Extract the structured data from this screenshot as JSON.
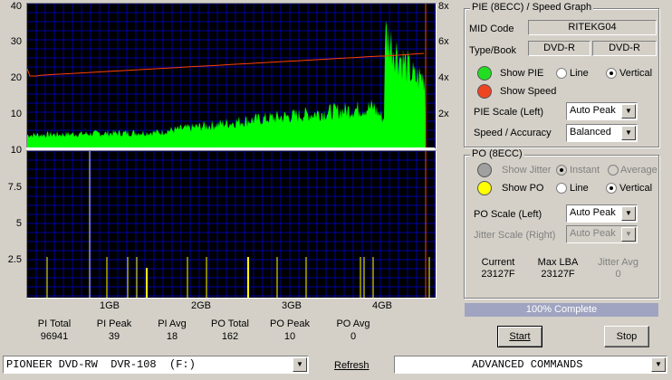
{
  "pie_chart": {
    "left_axis": [
      "40",
      "30",
      "20",
      "10"
    ],
    "right_axis": [
      "8x",
      "6x",
      "4x",
      "2x"
    ]
  },
  "po_chart": {
    "left_axis": [
      "10",
      "7.5",
      "5",
      "2.5"
    ],
    "x_axis": [
      "1GB",
      "2GB",
      "3GB",
      "4GB"
    ]
  },
  "stats": [
    {
      "label": "PI Total",
      "value": "96941"
    },
    {
      "label": "PI Peak",
      "value": "39"
    },
    {
      "label": "PI Avg",
      "value": "18"
    },
    {
      "label": "PO Total",
      "value": "162"
    },
    {
      "label": "PO Peak",
      "value": "10"
    },
    {
      "label": "PO Avg",
      "value": "0"
    }
  ],
  "pie_panel": {
    "title": "PIE (8ECC) / Speed Graph",
    "mid_code_label": "MID Code",
    "mid_code": "RITEKG04",
    "type_book_label": "Type/Book",
    "type": "DVD-R",
    "book": "DVD-R",
    "show_pie": "Show PIE",
    "show_speed": "Show Speed",
    "line": "Line",
    "vertical": "Vertical",
    "scale_label": "PIE Scale (Left)",
    "scale_value": "Auto Peak",
    "speed_label": "Speed / Accuracy",
    "speed_value": "Balanced"
  },
  "po_panel": {
    "title": "PO (8ECC)",
    "show_jitter": "Show Jitter",
    "instant": "Instant",
    "average": "Average",
    "show_po": "Show PO",
    "line": "Line",
    "vertical": "Vertical",
    "scale_label": "PO Scale (Left)",
    "scale_value": "Auto Peak",
    "jitter_label": "Jitter Scale (Right)",
    "jitter_value": "Auto Peak",
    "current_label": "Current",
    "current_value": "23127F",
    "maxlba_label": "Max LBA",
    "maxlba_value": "23127F",
    "jitteravg_label": "Jitter Avg",
    "jitteravg_value": "0"
  },
  "progress": {
    "text": "100% Complete",
    "fraction": 1.0
  },
  "buttons": {
    "start": "Start",
    "stop": "Stop"
  },
  "bottom": {
    "drive": "PIONEER DVD-RW  DVR-108  (F:)",
    "refresh": "Refresh",
    "commands": "ADVANCED COMMANDS"
  },
  "colors": {
    "pie": "#00ff00",
    "speed": "#ff4000",
    "po": "#ffff00",
    "grid": "#0000a0",
    "bg": "#000000"
  }
}
